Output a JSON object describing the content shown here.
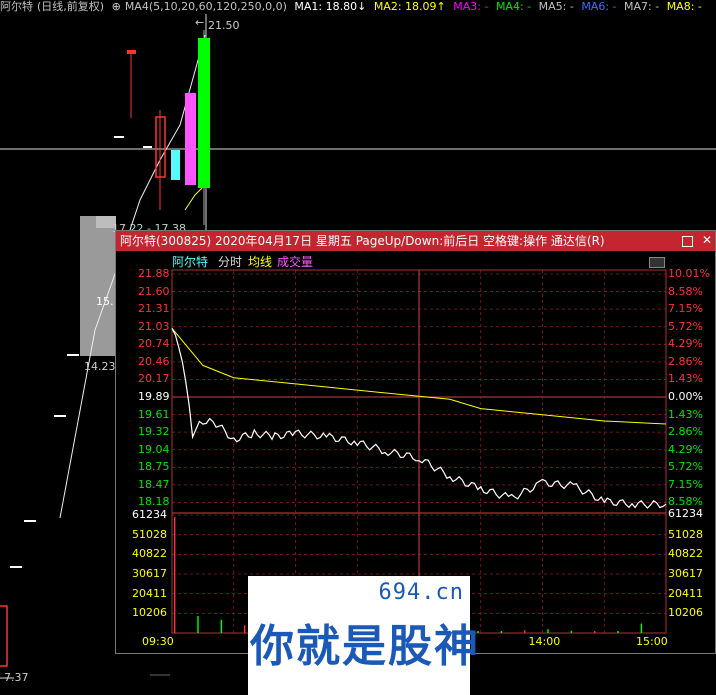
{
  "topbar": {
    "stock": "阿尔特",
    "period": "(日线,前复权)",
    "ma_group": "MA4(5,10,20,60,120,250,0,0)",
    "ma1": "MA1: 18.80↓",
    "ma2": "MA2: 18.09↑",
    "ma3": "MA3: -",
    "ma4": "MA4: -",
    "ma5": "MA5: -",
    "ma6": "MA6: -",
    "ma7": "MA7: -",
    "ma8": "MA8: -"
  },
  "kline": {
    "high_label": "21.50",
    "range_label": "17.22 - 17.38",
    "label_15": "15.",
    "label_14": "14.23",
    "low_label": "7.37"
  },
  "popup": {
    "title": "阿尔特(300825) 2020年04月17日 星期五 PageUp/Down:前后日 空格键:操作 通达信(R)",
    "tabs": {
      "name": "阿尔特",
      "fenshi": "分时",
      "junxian": "均线",
      "volume": "成交量"
    },
    "price_ticks": [
      "21.88",
      "21.60",
      "21.31",
      "21.03",
      "20.74",
      "20.46",
      "20.17",
      "19.89",
      "19.61",
      "19.32",
      "19.04",
      "18.75",
      "18.47",
      "18.18"
    ],
    "pct_ticks": [
      "10.01%",
      "8.58%",
      "7.15%",
      "5.72%",
      "4.29%",
      "2.86%",
      "1.43%",
      "0.00%",
      "1.43%",
      "2.86%",
      "4.29%",
      "5.72%",
      "7.15%",
      "8.58%"
    ],
    "volume_ticks": [
      "61234",
      "51028",
      "40822",
      "30617",
      "20411",
      "10206"
    ],
    "volume_right_top": "61234",
    "time_ticks": [
      "09:30",
      "14:00",
      "15:00"
    ]
  },
  "colors": {
    "up": "#ff3232",
    "down": "#54fcfc",
    "price_line": "#ffffff",
    "avg_line": "#ffff00",
    "grid": "#8b1e1e",
    "title_bg": "#c4252f"
  },
  "logo": {
    "domain": "694.cn",
    "text": "你就是股神"
  },
  "chart_data": {
    "type": "line",
    "title": "",
    "prev_close": 19.89,
    "price_range": [
      18.18,
      21.88
    ],
    "time_axis": [
      "09:30",
      "14:00",
      "15:00"
    ],
    "series": [
      {
        "values_time": [
          "09:30",
          "09:35",
          "09:40",
          "09:45",
          "09:50",
          "10:00",
          "10:10",
          "10:20",
          "10:30",
          "10:45",
          "11:00",
          "11:15",
          "11:30",
          "13:15",
          "13:30",
          "13:45",
          "14:00",
          "14:15",
          "14:30",
          "14:45",
          "15:00"
        ],
        "values": [
          21.0,
          20.5,
          19.3,
          19.5,
          19.5,
          19.2,
          19.3,
          19.25,
          19.3,
          19.25,
          19.15,
          19.0,
          18.9,
          18.6,
          18.4,
          18.25,
          18.5,
          18.45,
          18.2,
          18.15,
          18.15
        ]
      },
      {
        "values_time": [
          "09:30",
          "09:45",
          "10:00",
          "10:30",
          "11:00",
          "11:30",
          "13:15",
          "13:30",
          "14:00",
          "14:30",
          "15:00"
        ],
        "values": [
          21.0,
          20.4,
          20.2,
          20.1,
          20.0,
          19.9,
          19.85,
          19.7,
          19.6,
          19.5,
          19.45
        ]
      }
    ],
    "volume": [
      61234,
      9000,
      7000,
      4000,
      3500,
      3000,
      2500,
      2000,
      1800,
      1500,
      1200,
      1100,
      1000,
      900,
      800,
      1500,
      2000,
      1200,
      900,
      800,
      5000
    ]
  }
}
